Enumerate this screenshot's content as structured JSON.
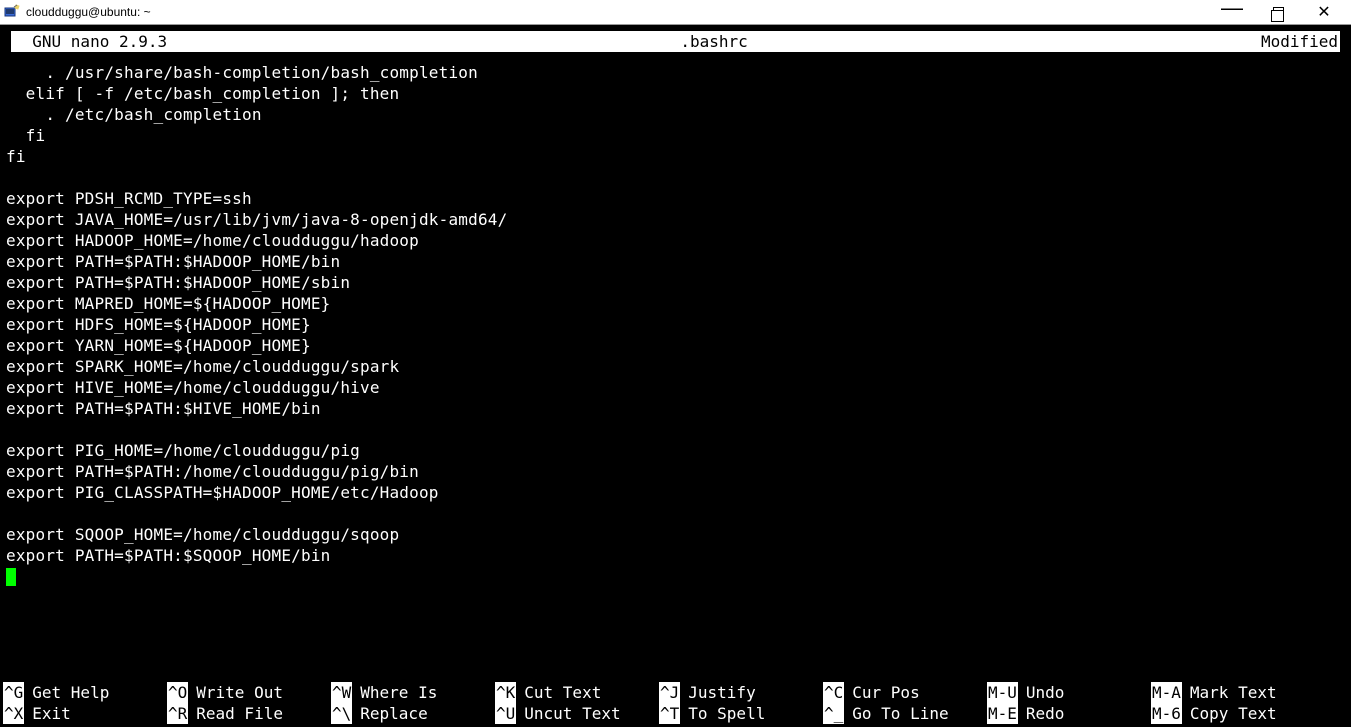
{
  "window": {
    "title": "cloudduggu@ubuntu: ~"
  },
  "nano": {
    "app": "  GNU nano 2.9.3",
    "filename": ".bashrc",
    "status": "Modified"
  },
  "content_lines": [
    "    . /usr/share/bash-completion/bash_completion",
    "  elif [ -f /etc/bash_completion ]; then",
    "    . /etc/bash_completion",
    "  fi",
    "fi",
    "",
    "export PDSH_RCMD_TYPE=ssh",
    "export JAVA_HOME=/usr/lib/jvm/java-8-openjdk-amd64/",
    "export HADOOP_HOME=/home/cloudduggu/hadoop",
    "export PATH=$PATH:$HADOOP_HOME/bin",
    "export PATH=$PATH:$HADOOP_HOME/sbin",
    "export MAPRED_HOME=${HADOOP_HOME}",
    "export HDFS_HOME=${HADOOP_HOME}",
    "export YARN_HOME=${HADOOP_HOME}",
    "export SPARK_HOME=/home/cloudduggu/spark",
    "export HIVE_HOME=/home/cloudduggu/hive",
    "export PATH=$PATH:$HIVE_HOME/bin",
    "",
    "export PIG_HOME=/home/cloudduggu/pig",
    "export PATH=$PATH:/home/cloudduggu/pig/bin",
    "export PIG_CLASSPATH=$HADOOP_HOME/etc/Hadoop",
    "",
    "export SQOOP_HOME=/home/cloudduggu/sqoop",
    "export PATH=$PATH:$SQOOP_HOME/bin"
  ],
  "shortcuts": {
    "row1": [
      {
        "key": "^G",
        "label": "Get Help"
      },
      {
        "key": "^O",
        "label": "Write Out"
      },
      {
        "key": "^W",
        "label": "Where Is"
      },
      {
        "key": "^K",
        "label": "Cut Text"
      },
      {
        "key": "^J",
        "label": "Justify"
      },
      {
        "key": "^C",
        "label": "Cur Pos"
      },
      {
        "key": "M-U",
        "label": "Undo"
      },
      {
        "key": "M-A",
        "label": "Mark Text"
      }
    ],
    "row2": [
      {
        "key": "^X",
        "label": "Exit"
      },
      {
        "key": "^R",
        "label": "Read File"
      },
      {
        "key": "^\\",
        "label": "Replace"
      },
      {
        "key": "^U",
        "label": "Uncut Text"
      },
      {
        "key": "^T",
        "label": "To Spell"
      },
      {
        "key": "^_",
        "label": "Go To Line"
      },
      {
        "key": "M-E",
        "label": "Redo"
      },
      {
        "key": "M-6",
        "label": "Copy Text"
      }
    ]
  }
}
